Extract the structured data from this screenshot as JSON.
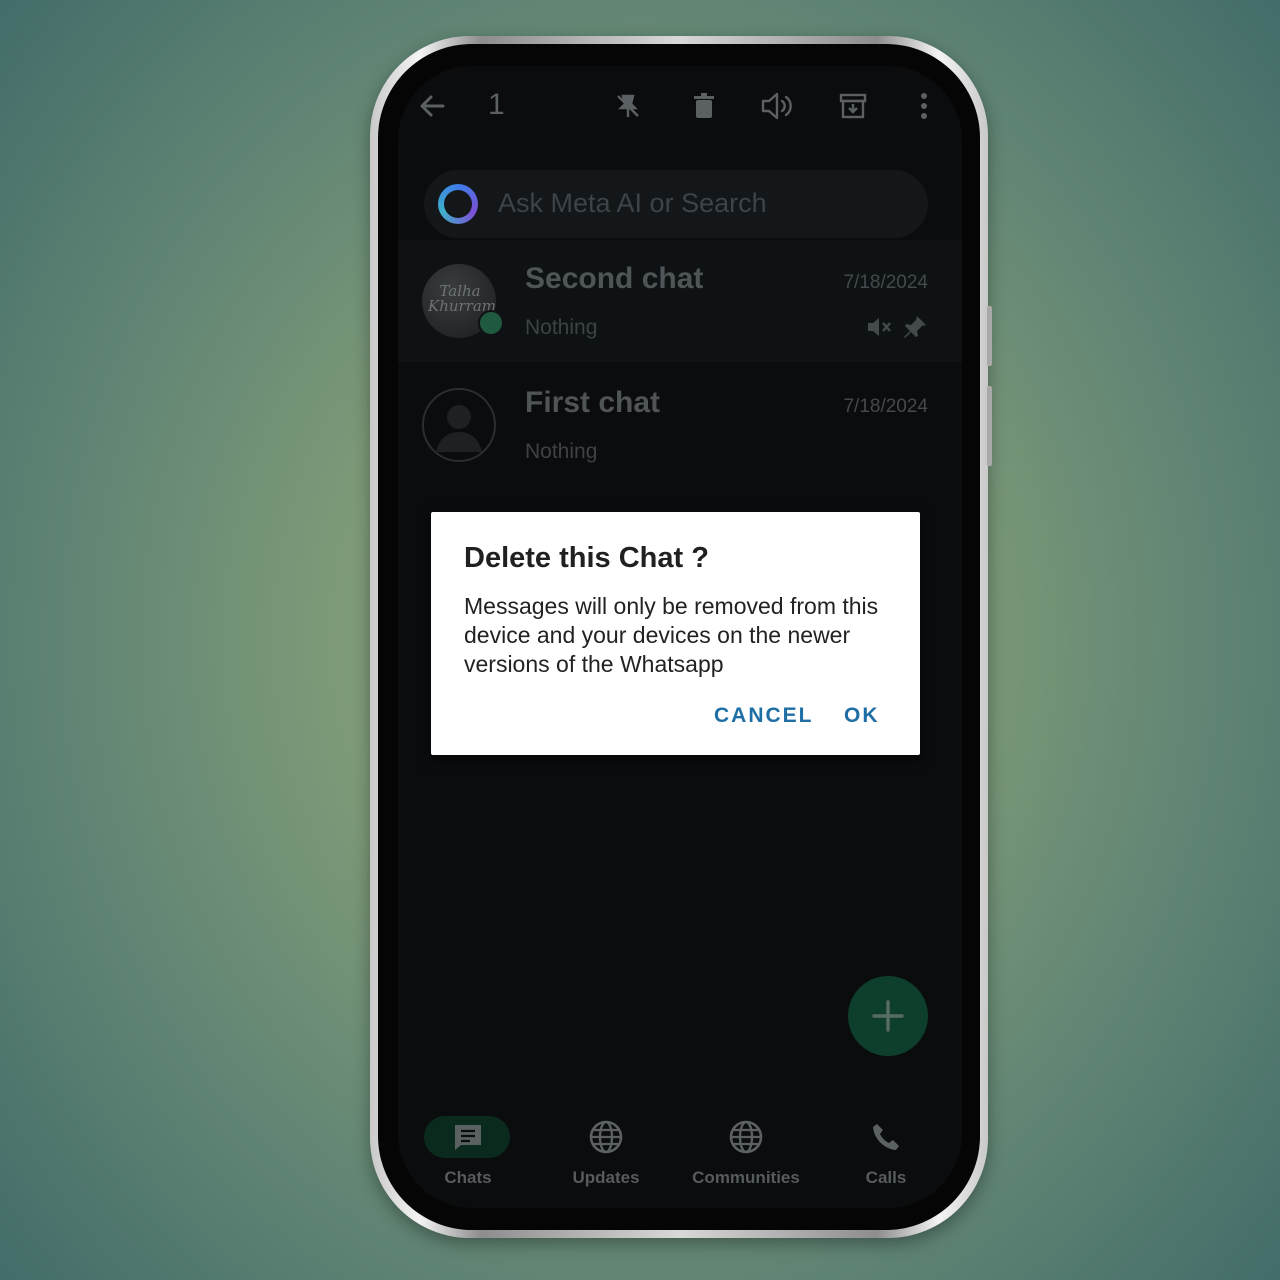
{
  "header": {
    "selected_count": "1",
    "icons": [
      "back-arrow-icon",
      "unpin-icon",
      "delete-icon",
      "unmute-icon",
      "archive-icon",
      "more-vert-icon"
    ]
  },
  "search": {
    "placeholder": "Ask Meta AI or Search"
  },
  "chats": [
    {
      "name": "Second chat",
      "preview": "Nothing",
      "date": "7/18/2024",
      "avatar_text": "Talha Khurram",
      "muted": true,
      "pinned": true,
      "selected": true
    },
    {
      "name": "First chat",
      "preview": "Nothing",
      "date": "7/18/2024",
      "muted": false,
      "pinned": false,
      "selected": false
    }
  ],
  "dialog": {
    "title": "Delete this Chat ?",
    "body": "Messages will only be removed from this device and your devices on the newer versions of the Whatsapp",
    "cancel_label": "CANCEL",
    "ok_label": "OK"
  },
  "nav": [
    {
      "label": "Chats",
      "icon": "chats-icon",
      "active": true
    },
    {
      "label": "Updates",
      "icon": "globe-icon"
    },
    {
      "label": "Communities",
      "icon": "globe-icon"
    },
    {
      "label": "Calls",
      "icon": "phone-icon"
    }
  ],
  "colors": {
    "accent": "#1f6fa6",
    "fab": "#0e3f2d",
    "screen_bg": "#0a0c0d"
  }
}
